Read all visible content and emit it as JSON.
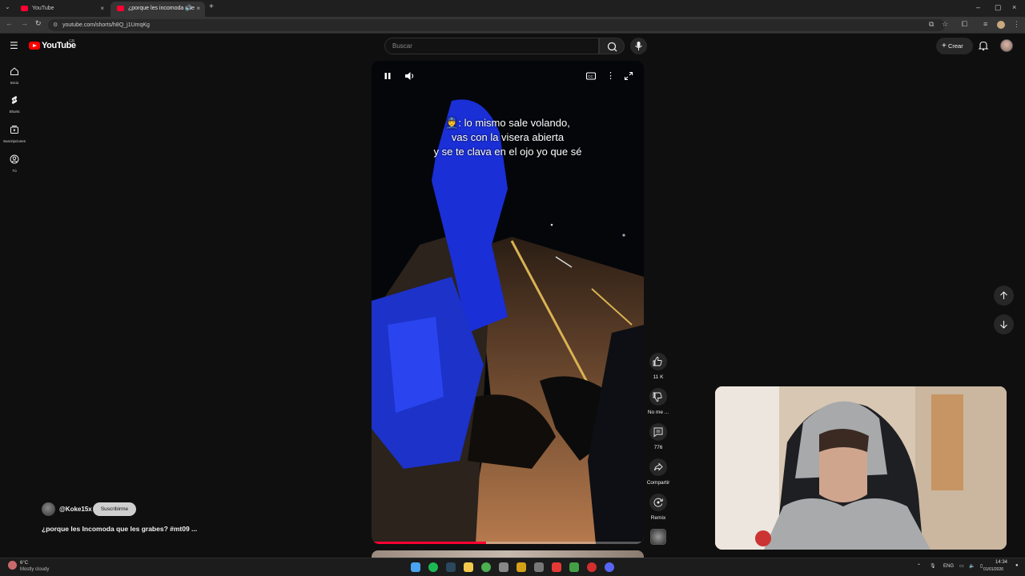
{
  "browser": {
    "tabs": [
      {
        "title": "YouTube",
        "close": "×"
      },
      {
        "title": "¿porque les incomoda que",
        "close": "×"
      }
    ],
    "new_tab": "+",
    "url": "youtube.com/shorts/h8Q_j1UmqKg",
    "window_controls": [
      "–",
      "▢",
      "×"
    ]
  },
  "youtube": {
    "logo_text": "YouTube",
    "logo_country": "GB",
    "search_placeholder": "Buscar",
    "create_label": "Crear"
  },
  "sidebar": {
    "items": [
      {
        "label": "Inicio",
        "icon": "home-icon"
      },
      {
        "label": "Shorts",
        "icon": "shorts-icon"
      },
      {
        "label": "Suscripciones",
        "icon": "subscriptions-icon"
      },
      {
        "label": "Tú",
        "icon": "you-icon"
      }
    ]
  },
  "video": {
    "subtitles": [
      ": lo mismo sale volando,",
      "vas con la visera abierta",
      "y se te clava en el ojo yo que sé"
    ],
    "subtitle_emoji": "👮",
    "progress": 0.42
  },
  "actions": {
    "like_count": "11 K",
    "dislike_label": "No me ...",
    "comments_count": "776",
    "share_label": "Compartir",
    "remix_label": "Remix"
  },
  "channel": {
    "handle": "@Koke15x",
    "subscribe_label": "Suscribirme"
  },
  "short": {
    "title": "¿porque les Incomoda que les grabes? #mt09 ..."
  },
  "taskbar": {
    "weather_temp": "6°C",
    "weather_desc": "Mostly cloudy",
    "language": "ENG",
    "time": "14:34",
    "date": "01/01/2026"
  },
  "colors": {
    "brand_red": "#ff0000",
    "background": "#0f0f0f",
    "progress_red": "#ff0033"
  }
}
